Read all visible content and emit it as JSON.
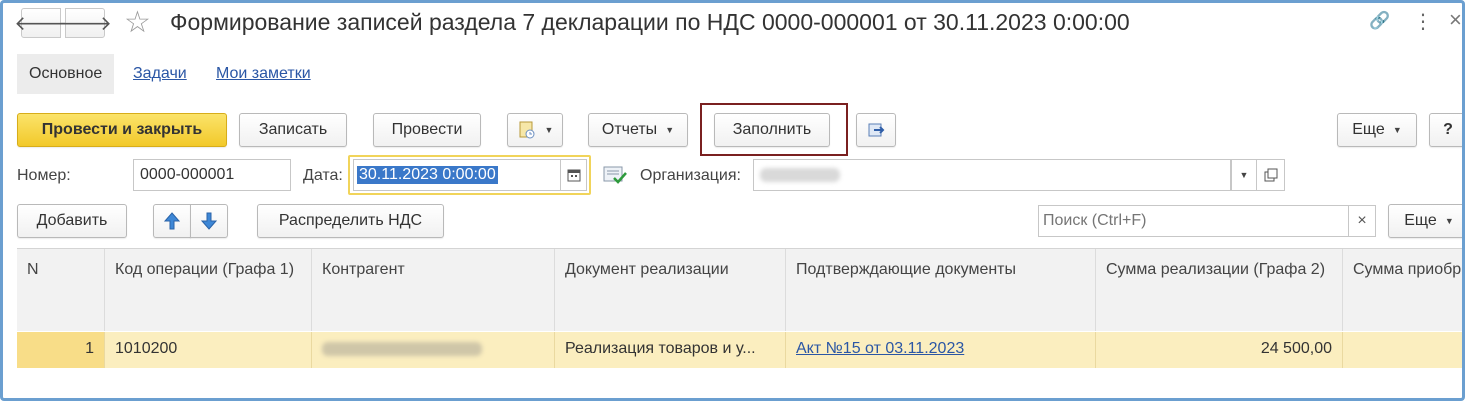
{
  "window": {
    "title": "Формирование записей раздела 7 декларации по НДС 0000-000001 от 30.11.2023 0:00:00",
    "nav_back": "🡐",
    "nav_forward": "🡒",
    "star": "☆",
    "link_icon": "🔗",
    "more_icon": "⋮",
    "close_icon": "×"
  },
  "tabs": [
    {
      "label": "Основное"
    },
    {
      "label": "Задачи"
    },
    {
      "label": "Мои заметки"
    }
  ],
  "toolbar": {
    "post_close": "Провести и закрыть",
    "save": "Записать",
    "post": "Провести",
    "reports": "Отчеты",
    "fill": "Заполнить",
    "more": "Еще",
    "help": "?"
  },
  "form": {
    "number_label": "Номер:",
    "number_value": "0000-000001",
    "date_label": "Дата:",
    "date_value": "30.11.2023  0:00:00",
    "org_label": "Организация:"
  },
  "table_toolbar": {
    "add": "Добавить",
    "distribute": "Распределить НДС",
    "search_placeholder": "Поиск (Ctrl+F)",
    "more": "Еще"
  },
  "table": {
    "columns": [
      "N",
      "Код операции (Графа 1)",
      "Контрагент",
      "Документ реализации",
      "Подтверждающие документы",
      "Сумма реализации (Графа 2)",
      "Сумма приобр"
    ],
    "rows": [
      {
        "n": "1",
        "code": "1010200",
        "doc": "Реализация товаров и у...",
        "confirm": "Акт №15 от 03.11.2023",
        "sum": "24 500,00"
      }
    ]
  },
  "colors": {
    "accent_yellow": "#f7d33a",
    "highlight_border": "#7a2020",
    "row_selected": "#fbeebf",
    "frame": "#6b9fd0"
  }
}
